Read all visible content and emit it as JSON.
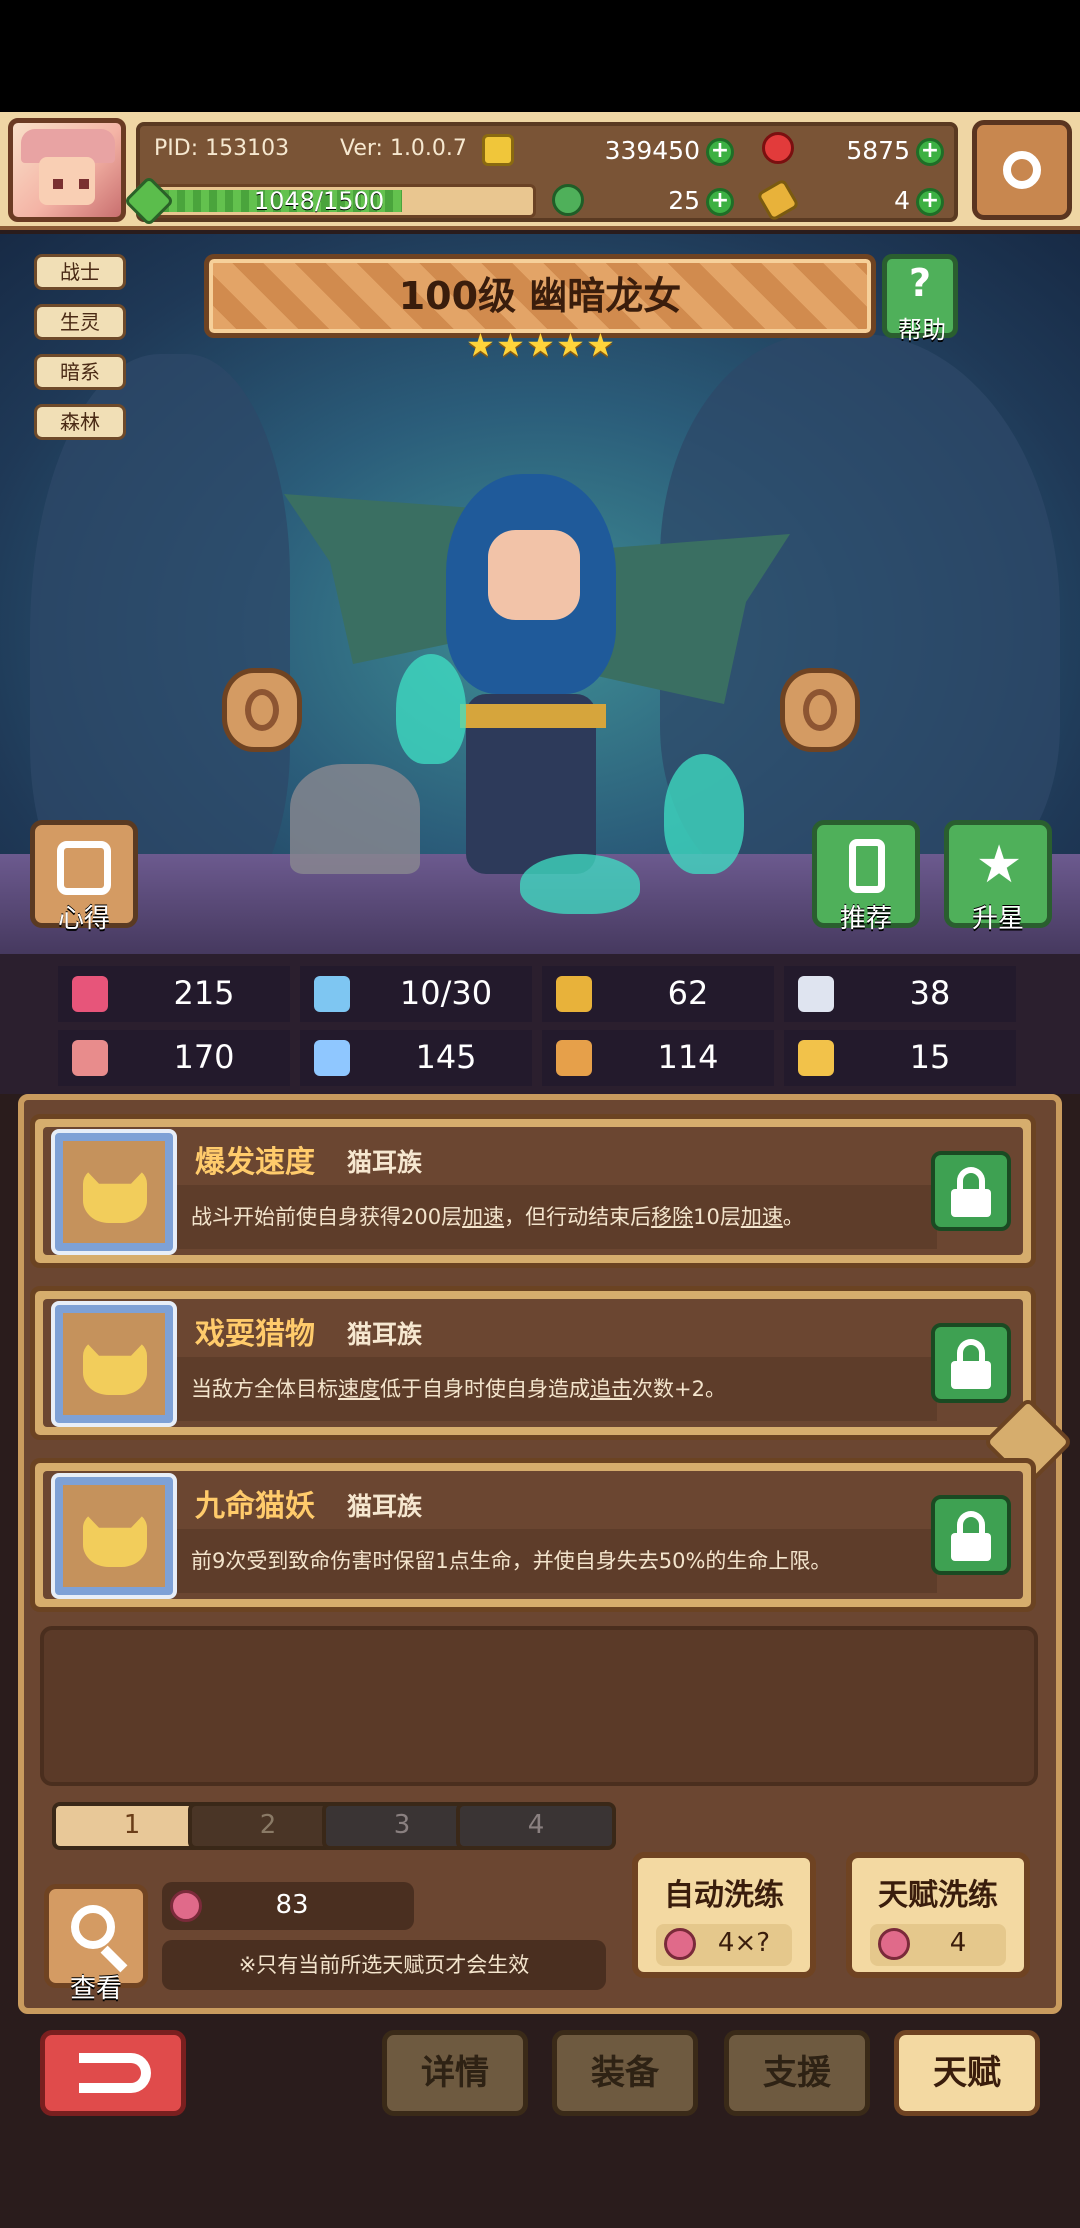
{
  "header": {
    "pid": "PID: 153103",
    "version": "Ver: 1.0.0.7",
    "exp": "1048/1500",
    "exp_fraction": 0.6987,
    "gold": "339450",
    "gems": "5875",
    "clover": "25",
    "keys": "4"
  },
  "hero": {
    "title": "100级 幽暗龙女",
    "stars": 5,
    "tags": [
      "战士",
      "生灵",
      "暗系",
      "森林"
    ],
    "help_label": "帮助",
    "tips_label": "心得",
    "recommend_label": "推荐",
    "starup_label": "升星"
  },
  "stats": [
    {
      "icon": "heart-icon",
      "value": "215",
      "color": "#e7557a"
    },
    {
      "icon": "mana-drop-icon",
      "value": "10/30",
      "color": "#7ec6f2"
    },
    {
      "icon": "shield-icon",
      "value": "62",
      "color": "#e8b23a"
    },
    {
      "icon": "wing-speed-icon",
      "value": "38",
      "color": "#dfe4f0"
    },
    {
      "icon": "fist-icon",
      "value": "170",
      "color": "#e88c8c"
    },
    {
      "icon": "spellbook-icon",
      "value": "145",
      "color": "#8fc7ff"
    },
    {
      "icon": "boot-icon",
      "value": "114",
      "color": "#e6a04a"
    },
    {
      "icon": "horseshoe-icon",
      "value": "15",
      "color": "#f2c24a"
    }
  ],
  "talents": [
    {
      "name": "爆发速度",
      "race": "猫耳族",
      "desc_parts": [
        "战斗开始前使自身获得200层",
        "加速",
        "，但行动结束后",
        "移除",
        "10层",
        "加速",
        "。"
      ]
    },
    {
      "name": "戏耍猎物",
      "race": "猫耳族",
      "desc_parts": [
        "当敌方全体目标",
        "速度",
        "低于自身时使自身造成",
        "追击",
        "次数+2。"
      ]
    },
    {
      "name": "九命猫妖",
      "race": "猫耳族",
      "desc_parts": [
        "前9次受到致命伤害时保留1点生命，并使自身失去50%的生命上限。"
      ]
    }
  ],
  "pages": [
    "1",
    "2",
    "3",
    "4"
  ],
  "reroll": {
    "fruit_count": "83",
    "note": "※只有当前所选天赋页才会生效",
    "look_label": "查看",
    "auto_title": "自动洗练",
    "auto_cost": "4×?",
    "talent_title": "天赋洗练",
    "talent_cost": "4"
  },
  "nav": {
    "details": "详情",
    "equip": "装备",
    "support": "支援",
    "talent": "天赋"
  }
}
